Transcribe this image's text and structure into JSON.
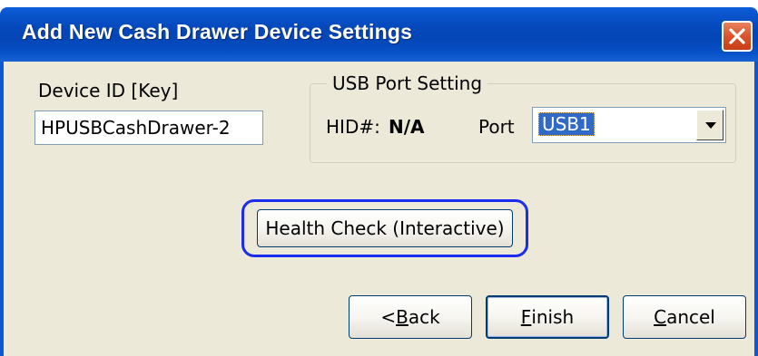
{
  "window": {
    "title": "Add New Cash Drawer Device Settings",
    "close_icon": "close-icon"
  },
  "device_id": {
    "label": "Device ID [Key]",
    "value": "HPUSBCashDrawer-2"
  },
  "usb_group": {
    "caption": "USB Port Setting",
    "hid_label": "HID#:",
    "hid_value": "N/A",
    "port_label": "Port",
    "port_value": "USB1",
    "dropdown_icon": "chevron-down-icon"
  },
  "health_check": {
    "label": "Health Check (Interactive)",
    "highlight_color": "#1a2cf0"
  },
  "footer": {
    "back_prefix": "< ",
    "back_mnemonic": "B",
    "back_rest": "ack",
    "finish_mnemonic": "F",
    "finish_rest": "inish",
    "cancel_mnemonic": "C",
    "cancel_rest": "ancel"
  },
  "colors": {
    "titlebar": "#0447b9",
    "dialog_face": "#ece9d8",
    "close_button": "#d9542c",
    "selection": "#316ac5"
  }
}
